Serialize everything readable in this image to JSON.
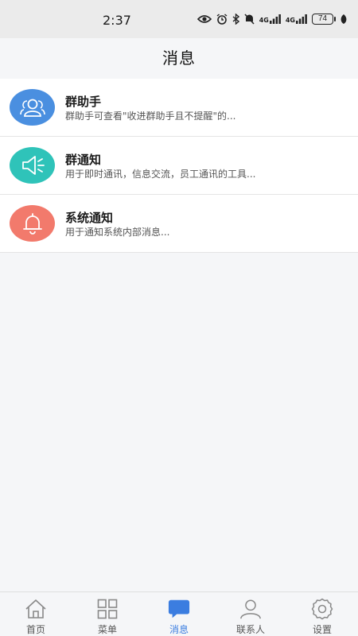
{
  "status_bar": {
    "time": "2:37",
    "network_1": "4G",
    "network_2": "4G",
    "battery": "74"
  },
  "header": {
    "title": "消息"
  },
  "messages": [
    {
      "title": "群助手",
      "subtitle": "群助手可查看\"收进群助手且不提醒\"的...",
      "icon": "group-icon",
      "color": "#4a8fe0"
    },
    {
      "title": "群通知",
      "subtitle": "用于即时通讯，信息交流，员工通讯的工具...",
      "icon": "speaker-icon",
      "color": "#2fc3b9"
    },
    {
      "title": "系统通知",
      "subtitle": "用于通知系统内部消息...",
      "icon": "bell-icon",
      "color": "#f27a6c"
    }
  ],
  "tabbar": {
    "active": "消息",
    "accent": "#3b7de0",
    "tabs": [
      {
        "label": "首页",
        "icon": "home-icon"
      },
      {
        "label": "菜单",
        "icon": "grid-icon"
      },
      {
        "label": "消息",
        "icon": "chat-icon"
      },
      {
        "label": "联系人",
        "icon": "contact-icon"
      },
      {
        "label": "设置",
        "icon": "gear-icon"
      }
    ]
  }
}
